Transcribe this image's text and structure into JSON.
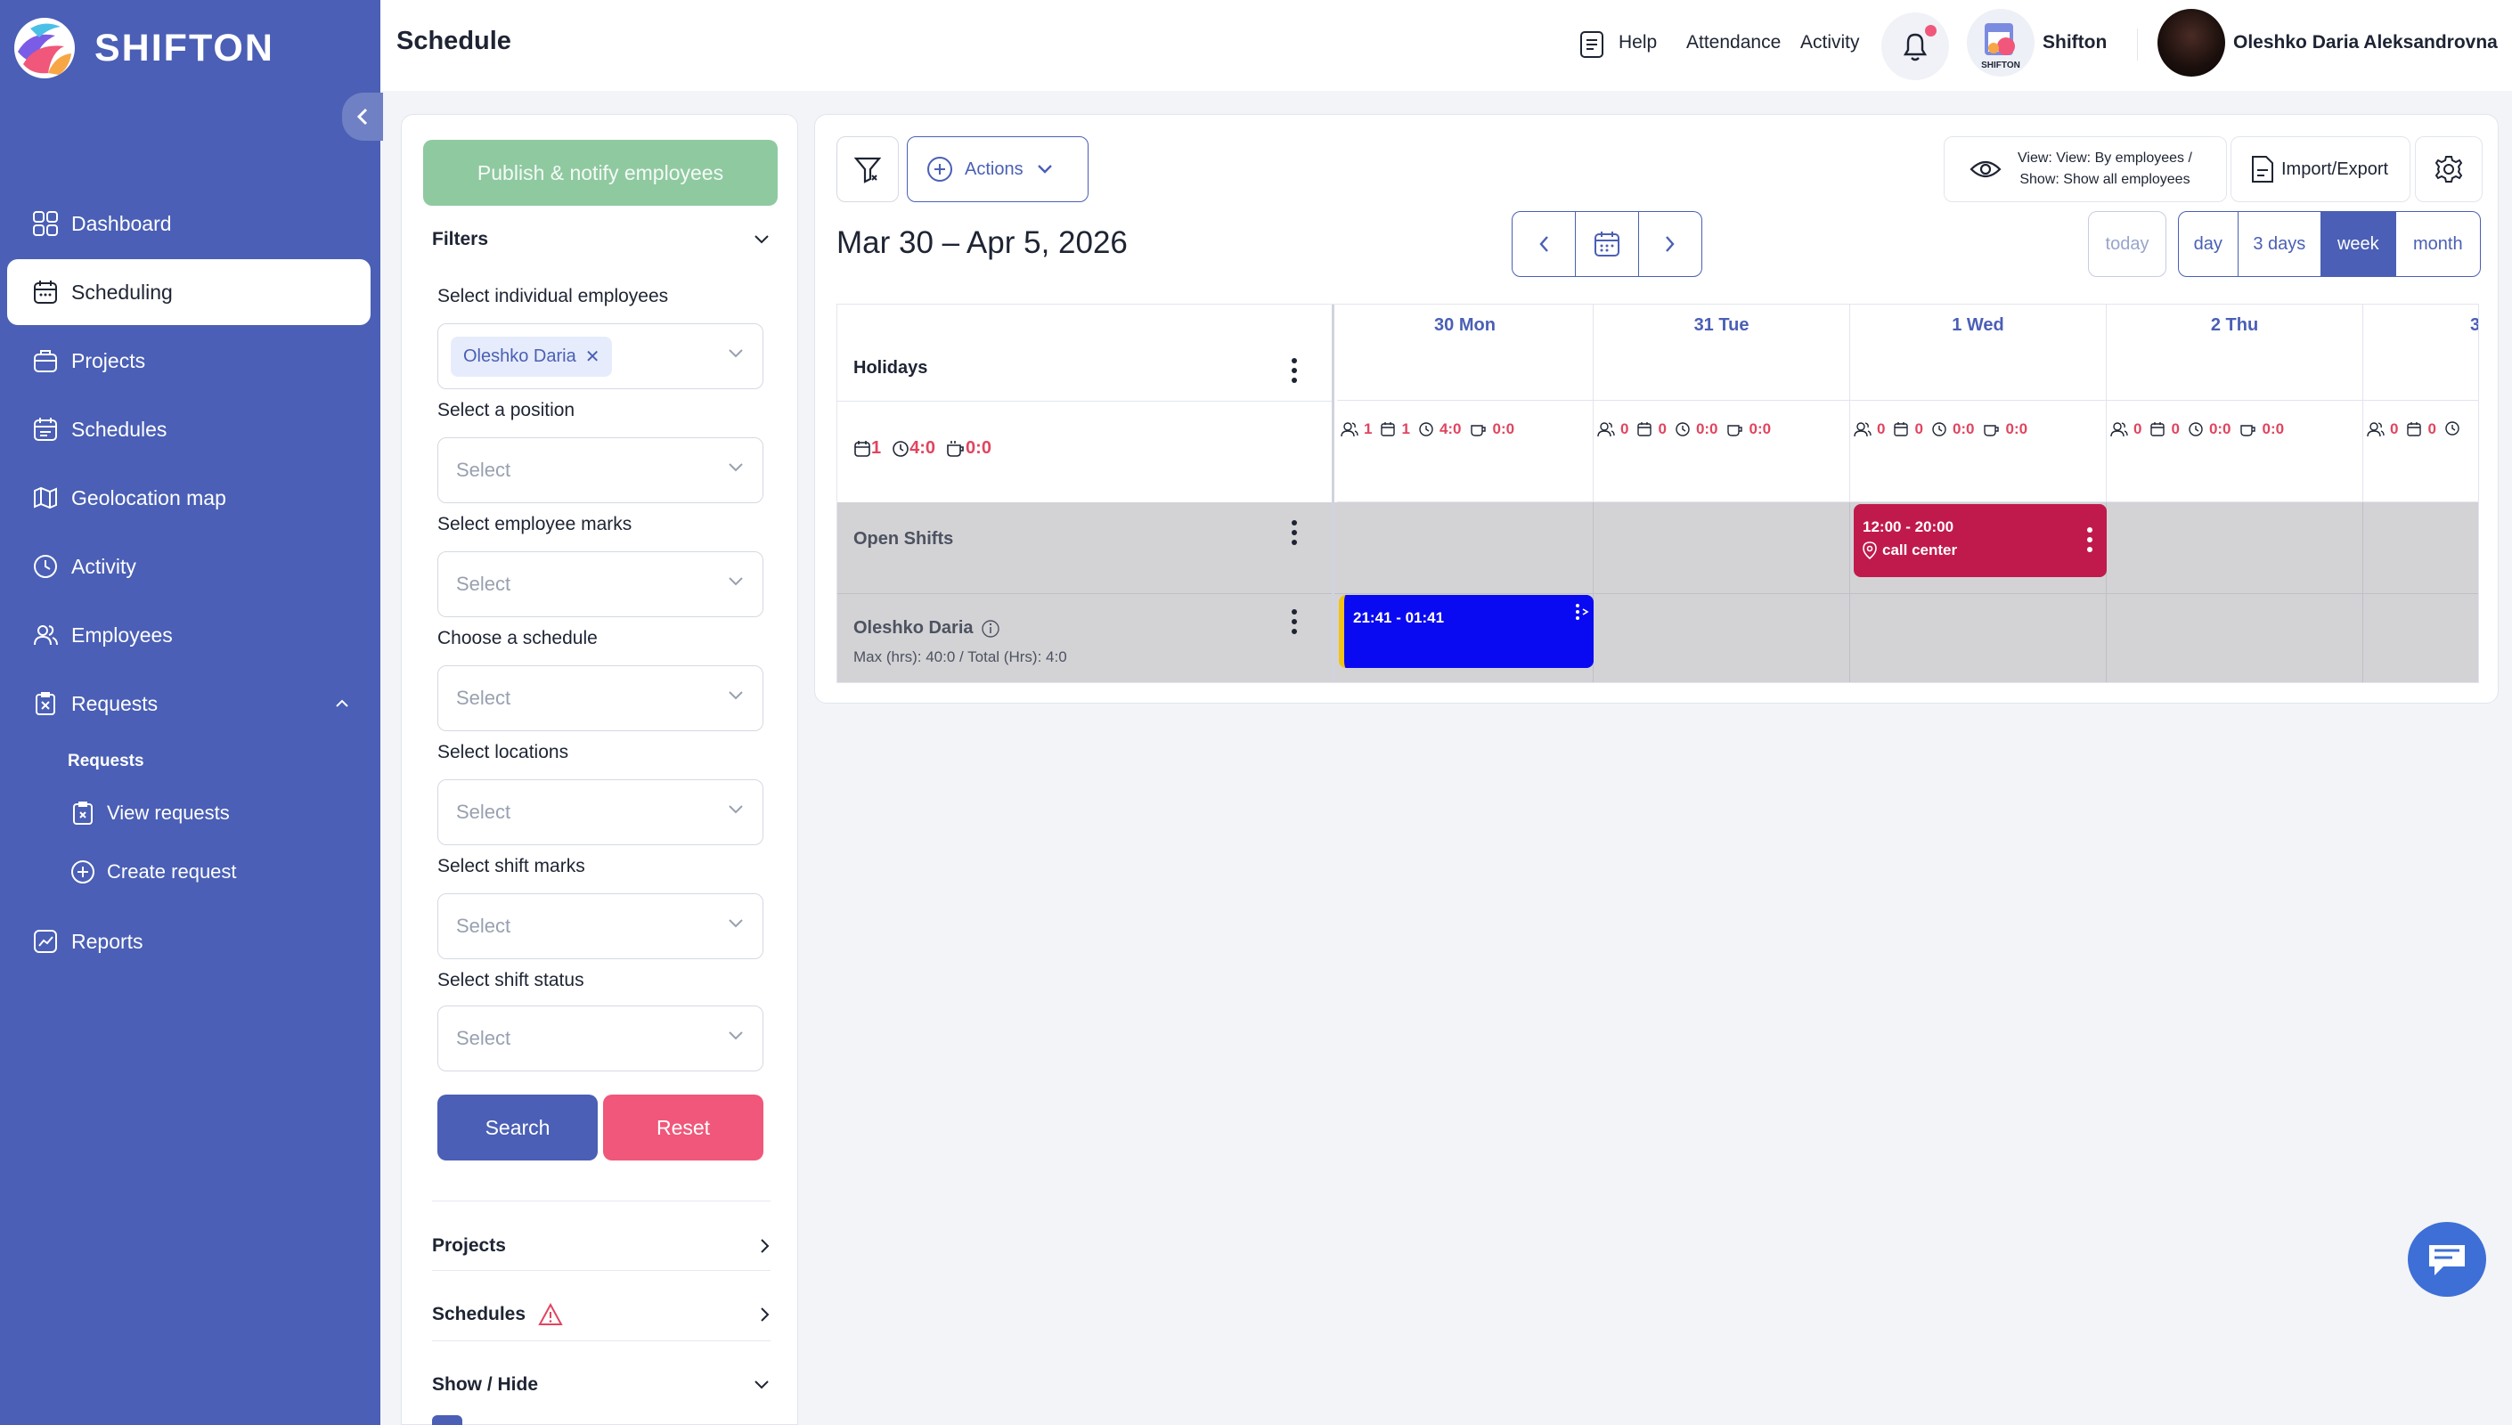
{
  "sidebar": {
    "logo": "SHIFTON",
    "items": [
      {
        "label": "Dashboard",
        "icon": "dashboard-icon"
      },
      {
        "label": "Scheduling",
        "icon": "calendar-icon"
      },
      {
        "label": "Projects",
        "icon": "briefcase-icon"
      },
      {
        "label": "Schedules",
        "icon": "calendar-icon"
      },
      {
        "label": "Geolocation map",
        "icon": "map-icon"
      },
      {
        "label": "Activity",
        "icon": "clock-icon"
      },
      {
        "label": "Employees",
        "icon": "users-icon"
      },
      {
        "label": "Requests",
        "icon": "request-icon"
      }
    ],
    "requests_section": "Requests",
    "view_requests": "View requests",
    "create_request": "Create request",
    "reports": "Reports"
  },
  "header": {
    "title": "Schedule",
    "help": "Help",
    "attendance": "Attendance",
    "activity": "Activity",
    "company": "Shifton",
    "company_logo_text": "SHIFTON",
    "user": "Oleshko Daria Aleksandrovna"
  },
  "filters": {
    "publish": "Publish & notify employees",
    "title": "Filters",
    "employees_label": "Select individual employees",
    "employee_chip": "Oleshko Daria",
    "position_label": "Select a position",
    "marks_label": "Select employee marks",
    "schedule_label": "Choose a schedule",
    "locations_label": "Select locations",
    "shift_marks_label": "Select shift marks",
    "shift_status_label": "Select shift status",
    "placeholder": "Select",
    "search": "Search",
    "reset": "Reset",
    "projects": "Projects",
    "schedules": "Schedules",
    "show_hide": "Show / Hide"
  },
  "toolbar": {
    "actions": "Actions",
    "view_line1": "View: View: By employees /",
    "view_line2": "Show: Show all employees",
    "import_export": "Import/Export",
    "date_range": "Mar 30 – Apr 5, 2026",
    "today": "today",
    "ranges": [
      "day",
      "3 days",
      "week",
      "month"
    ],
    "active_range": "week"
  },
  "grid": {
    "holidays": "Holidays",
    "summary": {
      "days": "1",
      "hours": "4:0",
      "breaks": "0:0"
    },
    "days": [
      {
        "label": "30 Mon",
        "people": "1",
        "shifts": "1",
        "hours": "4:0",
        "breaks": "0:0"
      },
      {
        "label": "31 Tue",
        "people": "0",
        "shifts": "0",
        "hours": "0:0",
        "breaks": "0:0"
      },
      {
        "label": "1 Wed",
        "people": "0",
        "shifts": "0",
        "hours": "0:0",
        "breaks": "0:0"
      },
      {
        "label": "2 Thu",
        "people": "0",
        "shifts": "0",
        "hours": "0:0",
        "breaks": "0:0"
      },
      {
        "label": "3",
        "people": "0",
        "shifts": "0",
        "hours": "",
        "breaks": ""
      }
    ],
    "open_shifts": "Open Shifts",
    "open_shift": {
      "time": "12:00 - 20:00",
      "location": "call center",
      "color": "#c01a4c"
    },
    "employee": {
      "name": "Oleshko Daria",
      "meta": "Max (hrs): 40:0 / Total (Hrs): 4:0"
    },
    "employee_shift": {
      "time": "21:41 - 01:41",
      "color": "#0a0af2"
    }
  },
  "colors": {
    "sidebar": "#4a5fb5",
    "accent": "#4a5fb5",
    "danger": "#f0577a",
    "publish": "#8fc9a0"
  }
}
